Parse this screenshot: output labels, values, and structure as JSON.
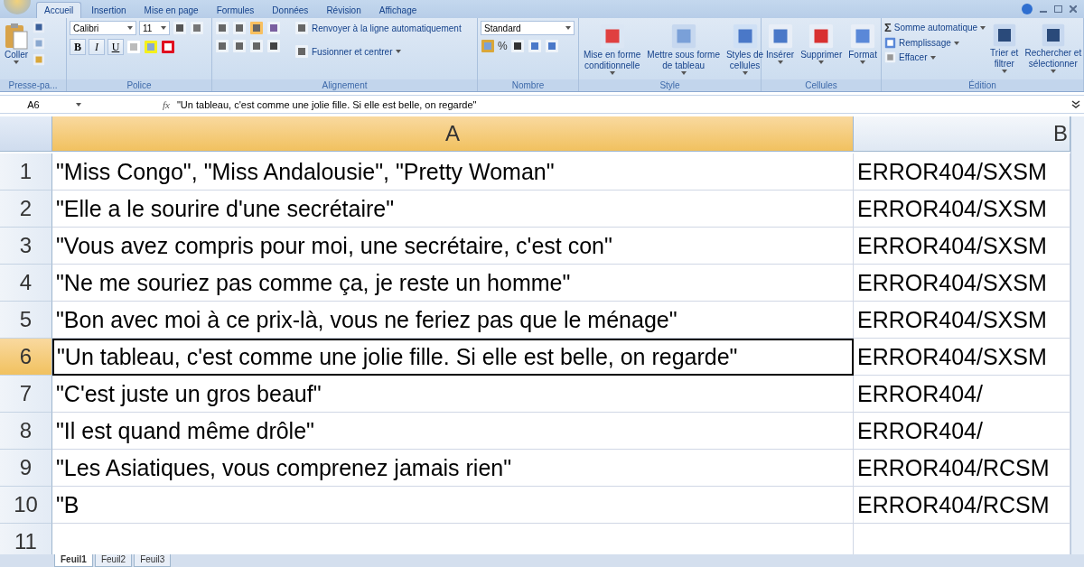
{
  "tabs": [
    {
      "label": "Accueil",
      "selected": true
    },
    {
      "label": "Insertion",
      "selected": false
    },
    {
      "label": "Mise en page",
      "selected": false
    },
    {
      "label": "Formules",
      "selected": false
    },
    {
      "label": "Données",
      "selected": false
    },
    {
      "label": "Révision",
      "selected": false
    },
    {
      "label": "Affichage",
      "selected": false
    }
  ],
  "ribbon": [
    {
      "kind": "clipboard",
      "label": "Presse-pa...",
      "paste": "Coller"
    },
    {
      "kind": "font",
      "label": "Police",
      "font": "Calibri",
      "size": "11",
      "bold": "B",
      "italic": "I",
      "underline": "U"
    },
    {
      "kind": "alignment",
      "label": "Alignement",
      "wrap": "Renvoyer à la ligne automatiquement",
      "merge": "Fusionner et centrer"
    },
    {
      "kind": "number",
      "label": "Nombre",
      "format": "Standard",
      "percent": "%"
    },
    {
      "kind": "big",
      "label": "Style",
      "buttons": [
        "Mise en forme\nconditionnelle",
        "Mettre sous forme\nde tableau",
        "Styles de\ncellules"
      ]
    },
    {
      "kind": "big",
      "label": "Cellules",
      "buttons": [
        "Insérer",
        "Supprimer",
        "Format"
      ]
    },
    {
      "kind": "editing",
      "label": "Édition",
      "sigma": "Σ",
      "items": [
        "Somme automatique",
        "Remplissage",
        "Effacer"
      ],
      "buttons": [
        "Trier et\nfiltrer",
        "Rechercher et\nsélectionner"
      ]
    }
  ],
  "formula_bar": {
    "name_box": "A6",
    "fx": "fx",
    "value": "\"Un tableau, c'est comme une jolie fille. Si elle est belle, on regarde\""
  },
  "columns": [
    {
      "label": "A",
      "selected": true
    },
    {
      "label": "B",
      "selected": false
    }
  ],
  "rows": [
    {
      "number": "1",
      "a": "\"Miss Congo\", \"Miss Andalousie\", \"Pretty Woman\"",
      "b": "ERROR404/SXSM",
      "selected": false
    },
    {
      "number": "2",
      "a": "\"Elle a le sourire d'une secrétaire\"",
      "b": "ERROR404/SXSM",
      "selected": false
    },
    {
      "number": "3",
      "a": "\"Vous avez compris pour moi, une secrétaire, c'est con\"",
      "b": "ERROR404/SXSM",
      "selected": false
    },
    {
      "number": "4",
      "a": "\"Ne me souriez pas comme ça, je reste un homme\"",
      "b": "ERROR404/SXSM",
      "selected": false
    },
    {
      "number": "5",
      "a": "\"Bon avec moi à ce prix-là, vous ne feriez pas que le ménage\"",
      "b": "ERROR404/SXSM",
      "selected": false
    },
    {
      "number": "6",
      "a": "\"Un tableau, c'est comme une jolie fille. Si elle est belle, on regarde\"",
      "b": "ERROR404/SXSM",
      "selected": true
    },
    {
      "number": "7",
      "a": "\"C'est juste un gros beauf\"",
      "b": "ERROR404/",
      "selected": false
    },
    {
      "number": "8",
      "a": "\"Il est quand même drôle\"",
      "b": "ERROR404/",
      "selected": false
    },
    {
      "number": "9",
      "a": "\"Les Asiatiques, vous comprenez jamais rien\"",
      "b": "ERROR404/RCSM",
      "selected": false
    },
    {
      "number": "10",
      "a": "\"B",
      "b": "ERROR404/RCSM",
      "selected": false
    },
    {
      "number": "11",
      "selected": false
    }
  ],
  "sheet_tabs": [
    {
      "label": "Feuil1",
      "selected": true
    },
    {
      "label": "Feuil2",
      "selected": false
    },
    {
      "label": "Feuil3",
      "selected": false
    }
  ]
}
